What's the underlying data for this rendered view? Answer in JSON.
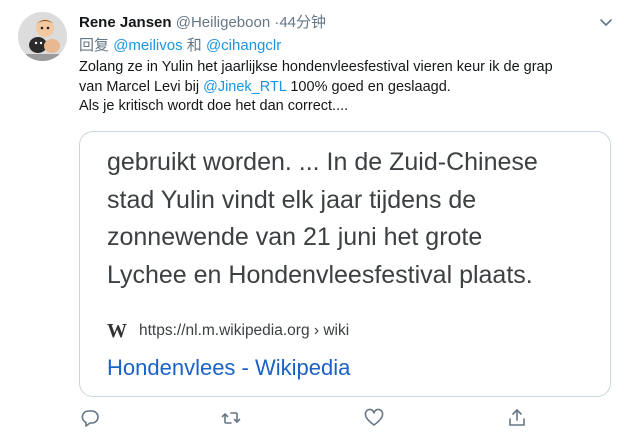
{
  "tweet": {
    "author_name": "Rene Jansen",
    "author_handle": "@Heiligeboon",
    "separator": "·",
    "time": "44分钟",
    "reply_prefix": "回复",
    "reply_user_1": "@meilivos",
    "reply_conjunction": "和",
    "reply_user_2": "@cihangclr",
    "body_line_1": "Zolang ze in Yulin het jaarlijkse hondenvleesfestival vieren keur ik de grap",
    "body_line_2_before": "van Marcel Levi bij ",
    "body_line_2_mention": "@Jinek_RTL",
    "body_line_2_after": " 100% goed en geslaagd.",
    "body_line_3": "Als je kritisch wordt doe het dan correct...."
  },
  "card": {
    "snippet_lines": [
      "gebruikt worden. ... In de Zuid-Chinese",
      "stad Yulin vindt elk jaar tijdens de",
      "zonnewende van 21 juni het grote",
      "Lychee en Hondenvleesfestival plaats."
    ],
    "logo_glyph": "W",
    "source": "https://nl.m.wikipedia.org › wiki",
    "title": "Hondenvlees - Wikipedia"
  },
  "icons": {
    "avatar": "cartoon-avatar-icon",
    "caret": "chevron-down-icon",
    "reply": "reply-icon",
    "retweet": "retweet-icon",
    "like": "heart-icon",
    "share": "share-icon"
  },
  "colors": {
    "text": "#14171a",
    "muted": "#657786",
    "link": "#1b95e0",
    "card_border": "#ccd6dd",
    "card_title": "#1a62c6"
  }
}
